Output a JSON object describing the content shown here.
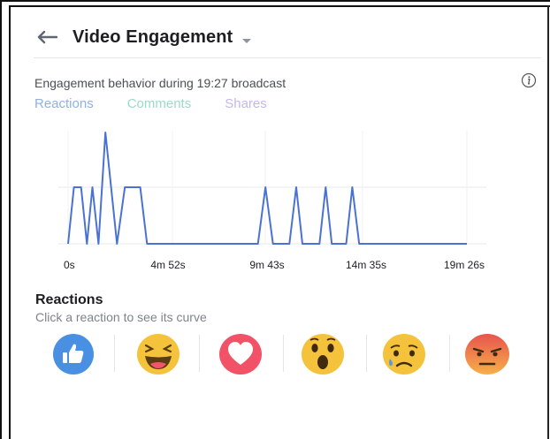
{
  "header": {
    "title": "Video Engagement"
  },
  "subtitle": "Engagement behavior during 19:27 broadcast",
  "tabs": [
    {
      "label": "Reactions",
      "color": "#8fb0e6"
    },
    {
      "label": "Comments",
      "color": "#9adcc7"
    },
    {
      "label": "Shares",
      "color": "#c4b7ef"
    }
  ],
  "chart_data": {
    "type": "line",
    "x_tick_labels": [
      "0s",
      "4m 52s",
      "9m 43s",
      "14m 35s",
      "19m 26s"
    ],
    "xlim_seconds": [
      0,
      1166
    ],
    "ylim": [
      0,
      2
    ],
    "grid": true,
    "series": [
      {
        "color": "#4a72d4",
        "points": [
          [
            0,
            0
          ],
          [
            17,
            1
          ],
          [
            38,
            1
          ],
          [
            55,
            0
          ],
          [
            71,
            1
          ],
          [
            89,
            0
          ],
          [
            109,
            2
          ],
          [
            143,
            0
          ],
          [
            166,
            1
          ],
          [
            211,
            1
          ],
          [
            231,
            0
          ],
          [
            555,
            0
          ],
          [
            577,
            1
          ],
          [
            599,
            0
          ],
          [
            647,
            0
          ],
          [
            667,
            1
          ],
          [
            685,
            0
          ],
          [
            735,
            0
          ],
          [
            753,
            1
          ],
          [
            771,
            0
          ],
          [
            813,
            0
          ],
          [
            831,
            1
          ],
          [
            851,
            0
          ],
          [
            1166,
            0
          ]
        ]
      }
    ]
  },
  "reactions_section": {
    "title": "Reactions",
    "hint": "Click a reaction to see its curve"
  },
  "reactions": [
    {
      "name": "like",
      "color": "#4a90e2"
    },
    {
      "name": "haha",
      "color": "#f5c33b"
    },
    {
      "name": "love",
      "color": "#f25268"
    },
    {
      "name": "wow",
      "color": "#f5c33b"
    },
    {
      "name": "sad",
      "color": "#f5c33b"
    },
    {
      "name": "angry",
      "color": "#f08a5d"
    }
  ]
}
